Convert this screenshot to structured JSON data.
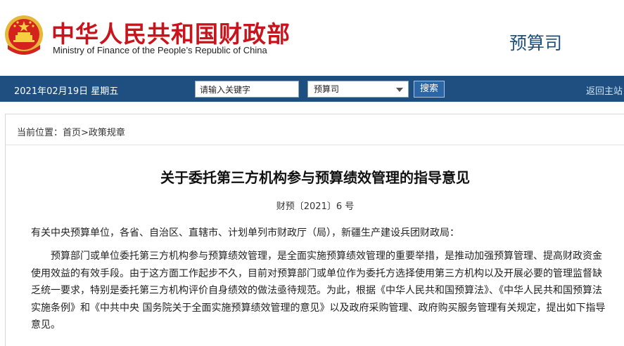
{
  "header": {
    "org_name_cn": "中华人民共和国财政部",
    "org_name_en": "Ministry of Finance of the People’s Republic of China",
    "department": "预算司"
  },
  "navbar": {
    "date": "2021年02月19日  星期五",
    "search_placeholder": "请输入关键字",
    "scope_selected": "预算司",
    "search_button": "搜索",
    "back_home": "返回主站"
  },
  "breadcrumb": "当前位置：首页>政策规章",
  "article": {
    "title": "关于委托第三方机构参与预算绩效管理的指导意见",
    "doc_number": "财预〔2021〕6 号",
    "salutation": "有关中央预算单位，各省、自治区、直辖市、计划单列市财政厅（局），新疆生产建设兵团财政局：",
    "paragraph_1": "预算部门或单位委托第三方机构参与预算绩效管理，是全面实施预算绩效管理的重要举措，是推动加强预算管理、提高财政资金使用效益的有效手段。由于这方面工作起步不久，目前对预算部门或单位作为委托方选择使用第三方机构以及开展必要的管理监督缺乏统一要求，特别是委托第三方机构评价自身绩效的做法亟待规范。为此，根据《中华人民共和国预算法》、《中华人民共和国预算法实施条例》和《中共中央  国务院关于全面实施预算绩效管理的意见》以及政府采购管理、政府购买服务管理有关规定，提出如下指导意见。"
  },
  "colors": {
    "brand_red": "#c8151d",
    "nav_blue": "#1e4f80",
    "dept_blue": "#1d4f7c"
  }
}
